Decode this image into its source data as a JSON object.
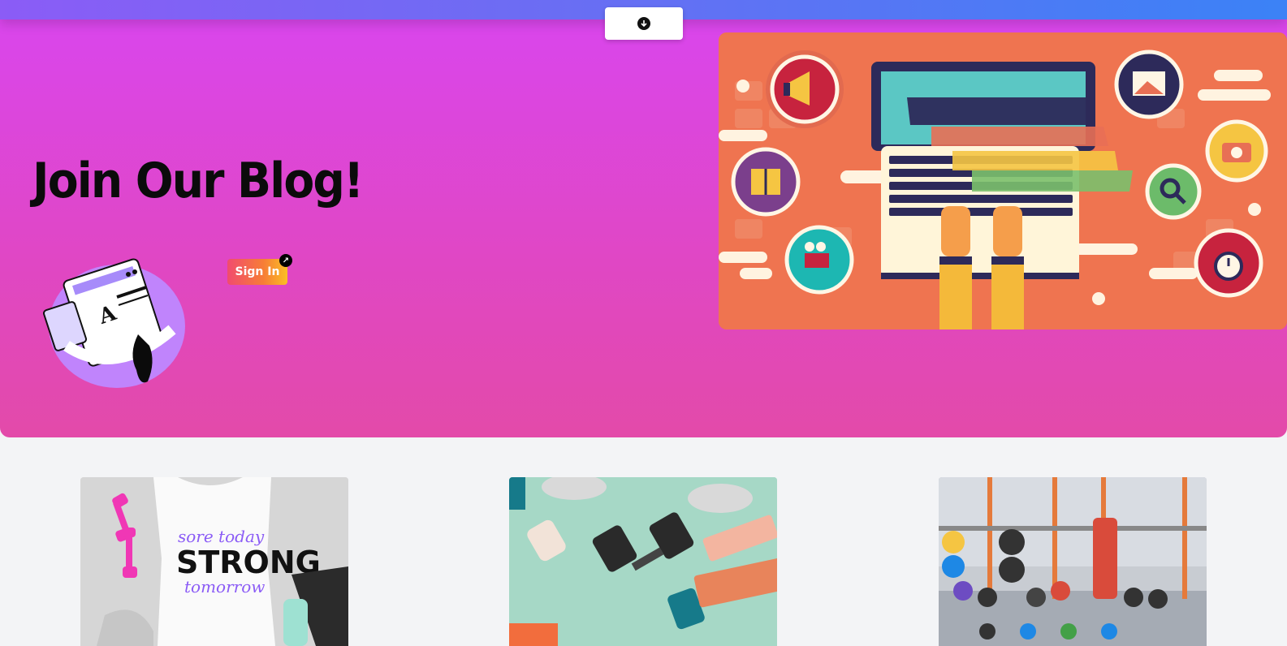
{
  "hero": {
    "title": "Join Our Blog!",
    "signin_label": "Sign In"
  },
  "icons": {
    "scroll_down": "arrow-down-circle-icon",
    "external_link": "external-link-icon",
    "megaphone": "megaphone-icon",
    "image": "image-icon",
    "book": "book-icon",
    "camera": "camera-icon",
    "search": "search-icon",
    "video": "video-camera-icon",
    "timer": "stopwatch-icon"
  },
  "cards": [
    {
      "image": "fitness-tank-top-photo",
      "shirt_line1": "sore today",
      "shirt_line2": "STRONG",
      "shirt_line3": "tomorrow"
    },
    {
      "image": "dumbbells-photo"
    },
    {
      "image": "gym-rack-photo"
    }
  ],
  "colors": {
    "hero_gradient_start": "#d946ef",
    "hero_gradient_end": "#e34aa9",
    "topbar_start": "#8b5cf6",
    "topbar_end": "#3b82f6",
    "signin_start": "#f14b6f",
    "signin_end": "#fbbf24",
    "illustration_bg": "#ef7450",
    "page_bg": "#f3f4f6"
  }
}
